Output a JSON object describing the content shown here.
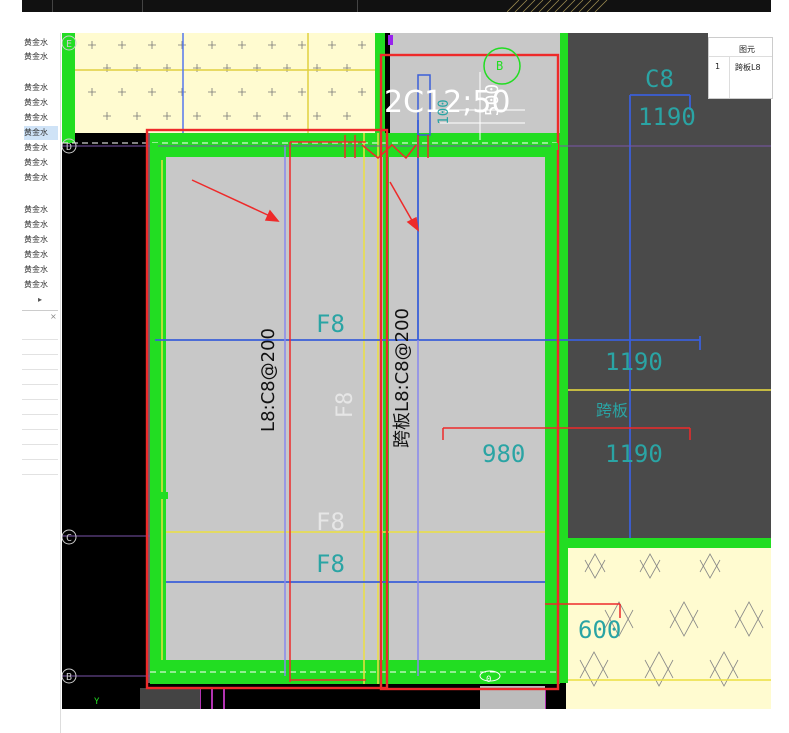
{
  "left_panel": {
    "group1": [
      "黄金水",
      "黄金水"
    ],
    "group2": [
      "黄金水",
      "黄金水",
      "黄金水",
      "黄金水",
      "黄金水",
      "黄金水",
      "黄金水"
    ],
    "group3": [
      "黄金水",
      "黄金水",
      "黄金水",
      "黄金水",
      "黄金水",
      "黄金水"
    ],
    "expand_arrow": "▸",
    "close_x": "×"
  },
  "property_table": {
    "header": "图元",
    "row_index": "1",
    "row_value": "跨板L8"
  },
  "drawing": {
    "axis_E": "E",
    "axis_D": "D",
    "axis_C": "C",
    "axis_B": "B",
    "axis_B_top": "B",
    "rebar_main": "L8:C8@200",
    "rebar_cross": "跨板L8:C8@200",
    "beam_annotation": "2C12;50",
    "dim_500": "500",
    "dim_100": "100",
    "dim_980": "980",
    "dim_600": "600",
    "label_F8_a": "F8",
    "label_F8_b": "F8",
    "label_F8_c": "F8",
    "label_F8_d": "F8",
    "label_C8": "C8",
    "label_1190_a": "1190",
    "label_1190_b": "1190",
    "label_1190_c": "1190",
    "label_cross": "跨板",
    "label_y": "Y",
    "label_0": "0"
  },
  "colors": {
    "slab_gray": "#c8c8c8",
    "beam_green": "#22dd22",
    "highlight_red": "#ee2a2a",
    "rebar_blue": "#3a5fd8",
    "text_teal": "#2aa4a4",
    "hatch_yellow": "#fffbd0"
  }
}
